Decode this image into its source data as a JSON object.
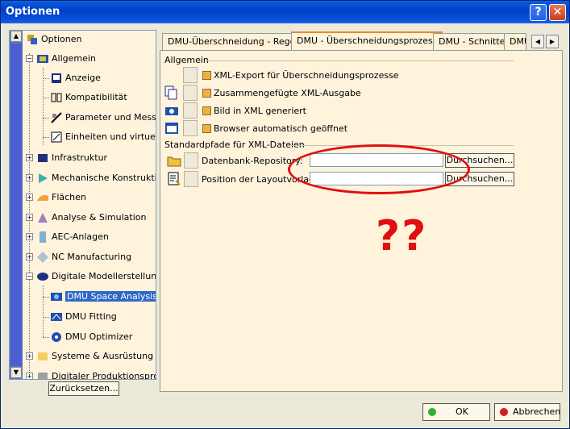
{
  "window": {
    "title": "Optionen",
    "help_label": "?",
    "close_label": "✕"
  },
  "tree": {
    "items": [
      {
        "label": "Optionen",
        "icon": "options-icon"
      },
      {
        "label": "Allgemein",
        "icon": "general-icon"
      },
      {
        "label": "Anzeige",
        "icon": "display-icon"
      },
      {
        "label": "Kompatibilität",
        "icon": "compatibility-icon"
      },
      {
        "label": "Parameter und Messung",
        "icon": "parameters-icon"
      },
      {
        "label": "Einheiten und virtuelle R",
        "icon": "units-icon"
      },
      {
        "label": "Infrastruktur",
        "icon": "infrastructure-icon"
      },
      {
        "label": "Mechanische Konstruktion",
        "icon": "mechanical-design-icon"
      },
      {
        "label": "Flächen",
        "icon": "surfaces-icon"
      },
      {
        "label": "Analyse & Simulation",
        "icon": "analysis-icon"
      },
      {
        "label": "AEC-Anlagen",
        "icon": "aec-icon"
      },
      {
        "label": "NC Manufacturing",
        "icon": "nc-manufacturing-icon"
      },
      {
        "label": "Digitale Modellerstellung",
        "icon": "digital-mockup-icon"
      },
      {
        "label": "DMU Space Analysis",
        "icon": "dmu-space-analysis-icon"
      },
      {
        "label": "DMU Fitting",
        "icon": "dmu-fitting-icon"
      },
      {
        "label": "DMU Optimizer",
        "icon": "dmu-optimizer-icon"
      },
      {
        "label": "Systeme & Ausrüstung",
        "icon": "systems-icon"
      },
      {
        "label": "Digitaler Produktionsprozes",
        "icon": "digital-process-icon"
      }
    ],
    "selected": "DMU Space Analysis",
    "reset_label": "Zurücksetzen..."
  },
  "tabs": [
    {
      "label": "DMU-Überschneidung - Regel"
    },
    {
      "label": "DMU - Überschneidungsprozess",
      "active": true
    },
    {
      "label": "DMU - Schnitte"
    },
    {
      "label": "DMU"
    }
  ],
  "general": {
    "title": "Allgemein",
    "options": [
      {
        "label": "XML-Export für Überschneidungsprozesse",
        "icon": "none"
      },
      {
        "label": "Zusammengefügte XML-Ausgabe",
        "icon": "merged-xml-icon"
      },
      {
        "label": "Bild in XML generiert",
        "icon": "camera-icon"
      },
      {
        "label": "Browser automatisch geöffnet",
        "icon": "browser-icon"
      }
    ]
  },
  "paths": {
    "title": "Standardpfade für XML-Dateien",
    "rows": [
      {
        "label": "Datenbank-Repository:",
        "value": "",
        "browse": "Durchsuchen...",
        "icon": "folder-icon"
      },
      {
        "label": "Position der Layoutvorlage:",
        "value": "",
        "browse": "Durchsuchen...",
        "icon": "layout-template-icon"
      }
    ]
  },
  "annotation": {
    "text": "??",
    "color": "#e01010"
  },
  "buttons": {
    "ok": "OK",
    "cancel": "Abbrechen"
  }
}
